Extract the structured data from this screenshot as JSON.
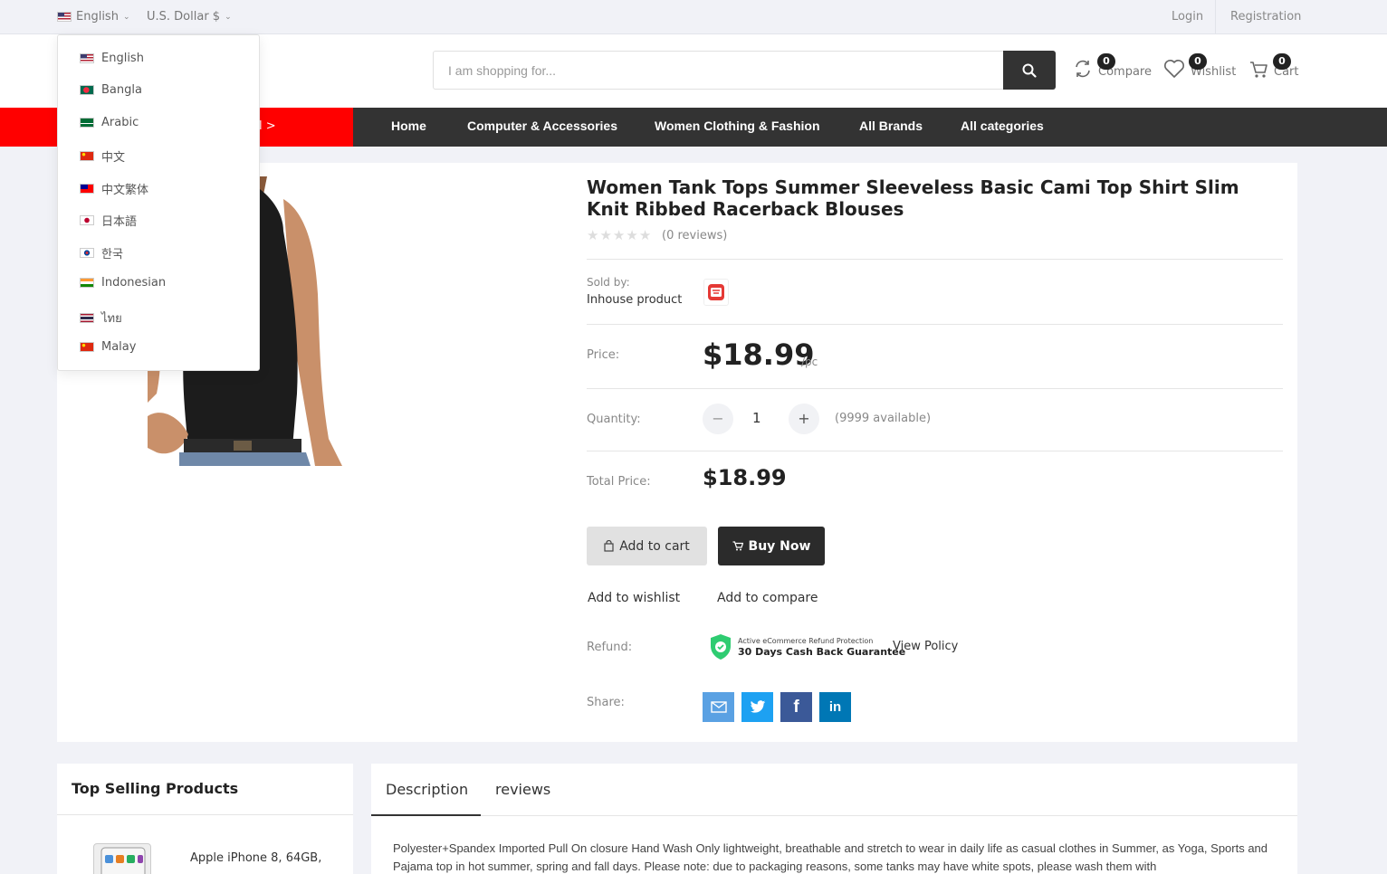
{
  "topbar": {
    "language": "English",
    "currency": "U.S. Dollar $",
    "login": "Login",
    "registration": "Registration"
  },
  "language_menu": [
    {
      "label": "English",
      "flag": "flag-us-icon"
    },
    {
      "label": "Bangla",
      "flag": "flag-bd-icon"
    },
    {
      "label": "Arabic",
      "flag": "flag-sa-icon"
    },
    {
      "label": "中文",
      "flag": "flag-cn-icon"
    },
    {
      "label": "中文繁体",
      "flag": "flag-tw-icon"
    },
    {
      "label": "日本語",
      "flag": "flag-jp-icon"
    },
    {
      "label": "한국",
      "flag": "flag-kr-icon"
    },
    {
      "label": "Indonesian",
      "flag": "flag-in-icon"
    },
    {
      "label": "ไทย",
      "flag": "flag-th-icon"
    },
    {
      "label": "Malay",
      "flag": "flag-cn-icon"
    }
  ],
  "header": {
    "search_placeholder": "I am shopping for...",
    "compare": {
      "label": "Compare",
      "count": "0"
    },
    "wishlist": {
      "label": "Wishlist",
      "count": "0"
    },
    "cart": {
      "label": "Cart",
      "count": "0"
    }
  },
  "nav": {
    "red_fragment": "l >",
    "items": [
      "Home",
      "Computer & Accessories",
      "Women Clothing & Fashion",
      "All Brands",
      "All categories"
    ]
  },
  "product": {
    "title": "Women Tank Tops Summer Sleeveless Basic Cami Top Shirt Slim Knit Ribbed Racerback Blouses",
    "rating": 0,
    "reviews": "(0 reviews)",
    "sold_by_label": "Sold by:",
    "sold_by_value": "Inhouse product",
    "price_label": "Price:",
    "price": "$18.99",
    "unit": "/pc",
    "quantity_label": "Quantity:",
    "quantity": "1",
    "available": "(9999 available)",
    "total_label": "Total Price:",
    "total": "$18.99",
    "add_to_cart": "Add to cart",
    "buy_now": "Buy Now",
    "add_to_wishlist": "Add to wishlist",
    "add_to_compare": "Add to compare",
    "refund_label": "Refund:",
    "refund_small": "Active eCommerce Refund Protection",
    "refund_big": "30 Days Cash Back Guarantee",
    "view_policy": "View Policy",
    "share_label": "Share:"
  },
  "top_selling": {
    "title": "Top Selling Products",
    "items": [
      {
        "name": "Apple iPhone 8, 64GB,"
      }
    ]
  },
  "tabs": {
    "description": "Description",
    "reviews": "reviews",
    "text": "Polyester+Spandex Imported Pull On closure Hand Wash Only lightweight, breathable and stretch to wear in daily life as casual clothes in Summer, as Yoga, Sports and Pajama top in hot summer, spring and fall days. Please note: due to packaging reasons, some tanks may have white spots, please wash them with"
  },
  "colors": {
    "accent_red": "#ff0000",
    "nav_bg": "#333333",
    "buy_now_bg": "#2b2b2b",
    "email": "#5aa1e3",
    "twitter": "#1da1f2",
    "facebook": "#3b5998",
    "linkedin": "#0077b5"
  }
}
